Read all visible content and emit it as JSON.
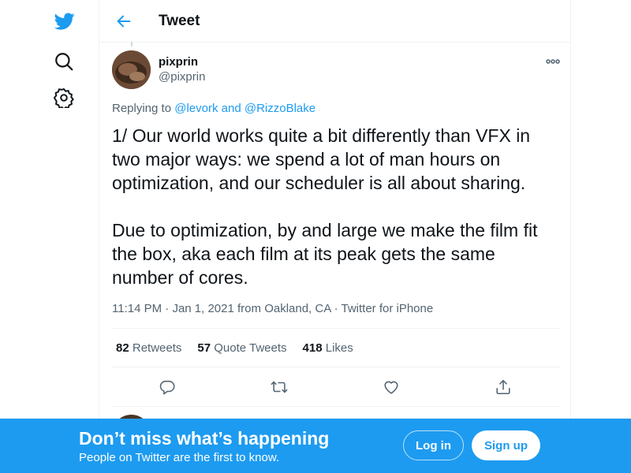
{
  "header": {
    "title": "Tweet"
  },
  "tweet": {
    "display_name": "pixprin",
    "handle": "@pixprin",
    "replying_prefix": "Replying to",
    "replying_user1": "@levork",
    "replying_and": "and",
    "replying_user2": "@RizzoBlake",
    "text_p1": "1/ Our world works quite a bit differently than VFX in two major ways: we spend a lot of man hours on optimization, and our scheduler is all about sharing.",
    "text_p2": "Due to optimization, by and large we make the film fit the box, aka each film at its peak gets the same number of cores.",
    "time": "11:14 PM",
    "date": "Jan 1, 2021",
    "from": "from",
    "location": "Oakland, CA",
    "dot": "·",
    "source": "Twitter for iPhone"
  },
  "stats": {
    "retweets_count": "82",
    "retweets_label": "Retweets",
    "quotes_count": "57",
    "quotes_label": "Quote Tweets",
    "likes_count": "418",
    "likes_label": "Likes"
  },
  "banner": {
    "title": "Don’t miss what’s happening",
    "subtitle": "People on Twitter are the first to know.",
    "login_label": "Log in",
    "signup_label": "Sign up"
  },
  "colors": {
    "accent": "#1d9bf0",
    "text": "#0f1419",
    "muted": "#536471",
    "border": "#eff3f4"
  },
  "icons": [
    "twitter-logo-icon",
    "search-icon",
    "gear-icon",
    "back-arrow-icon",
    "more-icon",
    "reply-icon",
    "retweet-icon",
    "like-icon",
    "share-icon"
  ]
}
